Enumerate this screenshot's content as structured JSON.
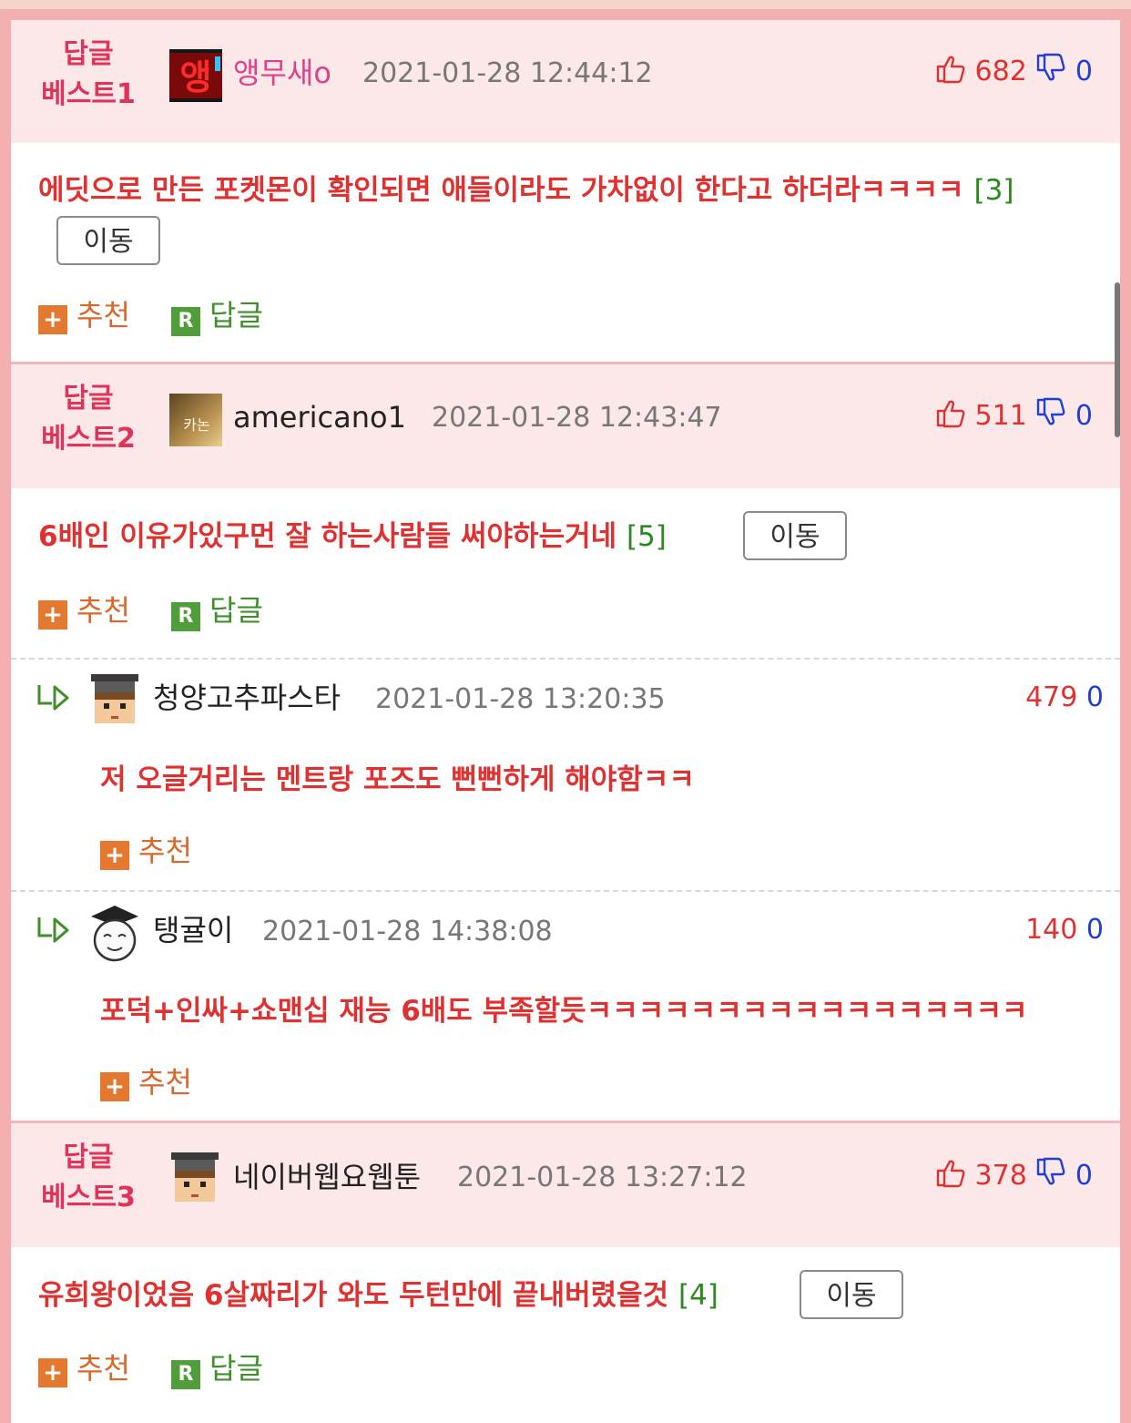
{
  "comments": [
    {
      "badge_line1": "답글",
      "badge_line2": "베스트1",
      "nickname": "앵무새o",
      "avatar_text": "앵",
      "date": "2021-01-28 12:44:12",
      "up": "682",
      "down": "0",
      "text": "에딧으로 만든 포켓몬이 확인되면 애들이라도 가차없이 한다고 하더라ㅋㅋㅋㅋ",
      "reply_count": "[3]",
      "move_label": "이동",
      "recommend_label": "추천",
      "reply_label": "답글"
    },
    {
      "badge_line1": "답글",
      "badge_line2": "베스트2",
      "nickname": "americano1",
      "avatar_text": "카논",
      "date": "2021-01-28 12:43:47",
      "up": "511",
      "down": "0",
      "text": "6배인 이유가있구먼 잘 하는사람들 써야하는거네",
      "reply_count": "[5]",
      "move_label": "이동",
      "recommend_label": "추천",
      "reply_label": "답글"
    },
    {
      "badge_line1": "답글",
      "badge_line2": "베스트3",
      "nickname": "네이버웹요웹툰",
      "date": "2021-01-28 13:27:12",
      "up": "378",
      "down": "0",
      "text": "유희왕이었음 6살짜리가 와도 두턴만에 끝내버렸을것",
      "reply_count": "[4]",
      "move_label": "이동",
      "recommend_label": "추천",
      "reply_label": "답글"
    }
  ],
  "replies": [
    {
      "nickname": "청양고추파스타",
      "date": "2021-01-28 13:20:35",
      "up": "479",
      "down": "0",
      "text": "저 오글거리는 멘트랑 포즈도 뻔뻔하게 해야함ㅋㅋ",
      "recommend_label": "추천"
    },
    {
      "nickname": "탱귤이",
      "date": "2021-01-28 14:38:08",
      "up": "140",
      "down": "0",
      "text": "포덕+인싸+쇼맨십 재능 6배도 부족할듯ㅋㅋㅋㅋㅋㅋㅋㅋㅋㅋㅋㅋㅋㅋㅋㅋㅋ",
      "recommend_label": "추천"
    }
  ],
  "colors": {
    "accent_red": "#e03131",
    "badge_pink": "#e0335a",
    "reply_green": "#2b8a1e",
    "down_blue": "#1f3fd6",
    "header_bg": "#fce8e8",
    "frame_pink": "#f4b0b0"
  },
  "icons": {
    "thumbs_up": "thumbs-up-icon",
    "thumbs_down": "thumbs-down-icon",
    "plus": "plus-icon",
    "reply": "r-reply-icon",
    "reply_arrow": "reply-arrow-icon"
  }
}
